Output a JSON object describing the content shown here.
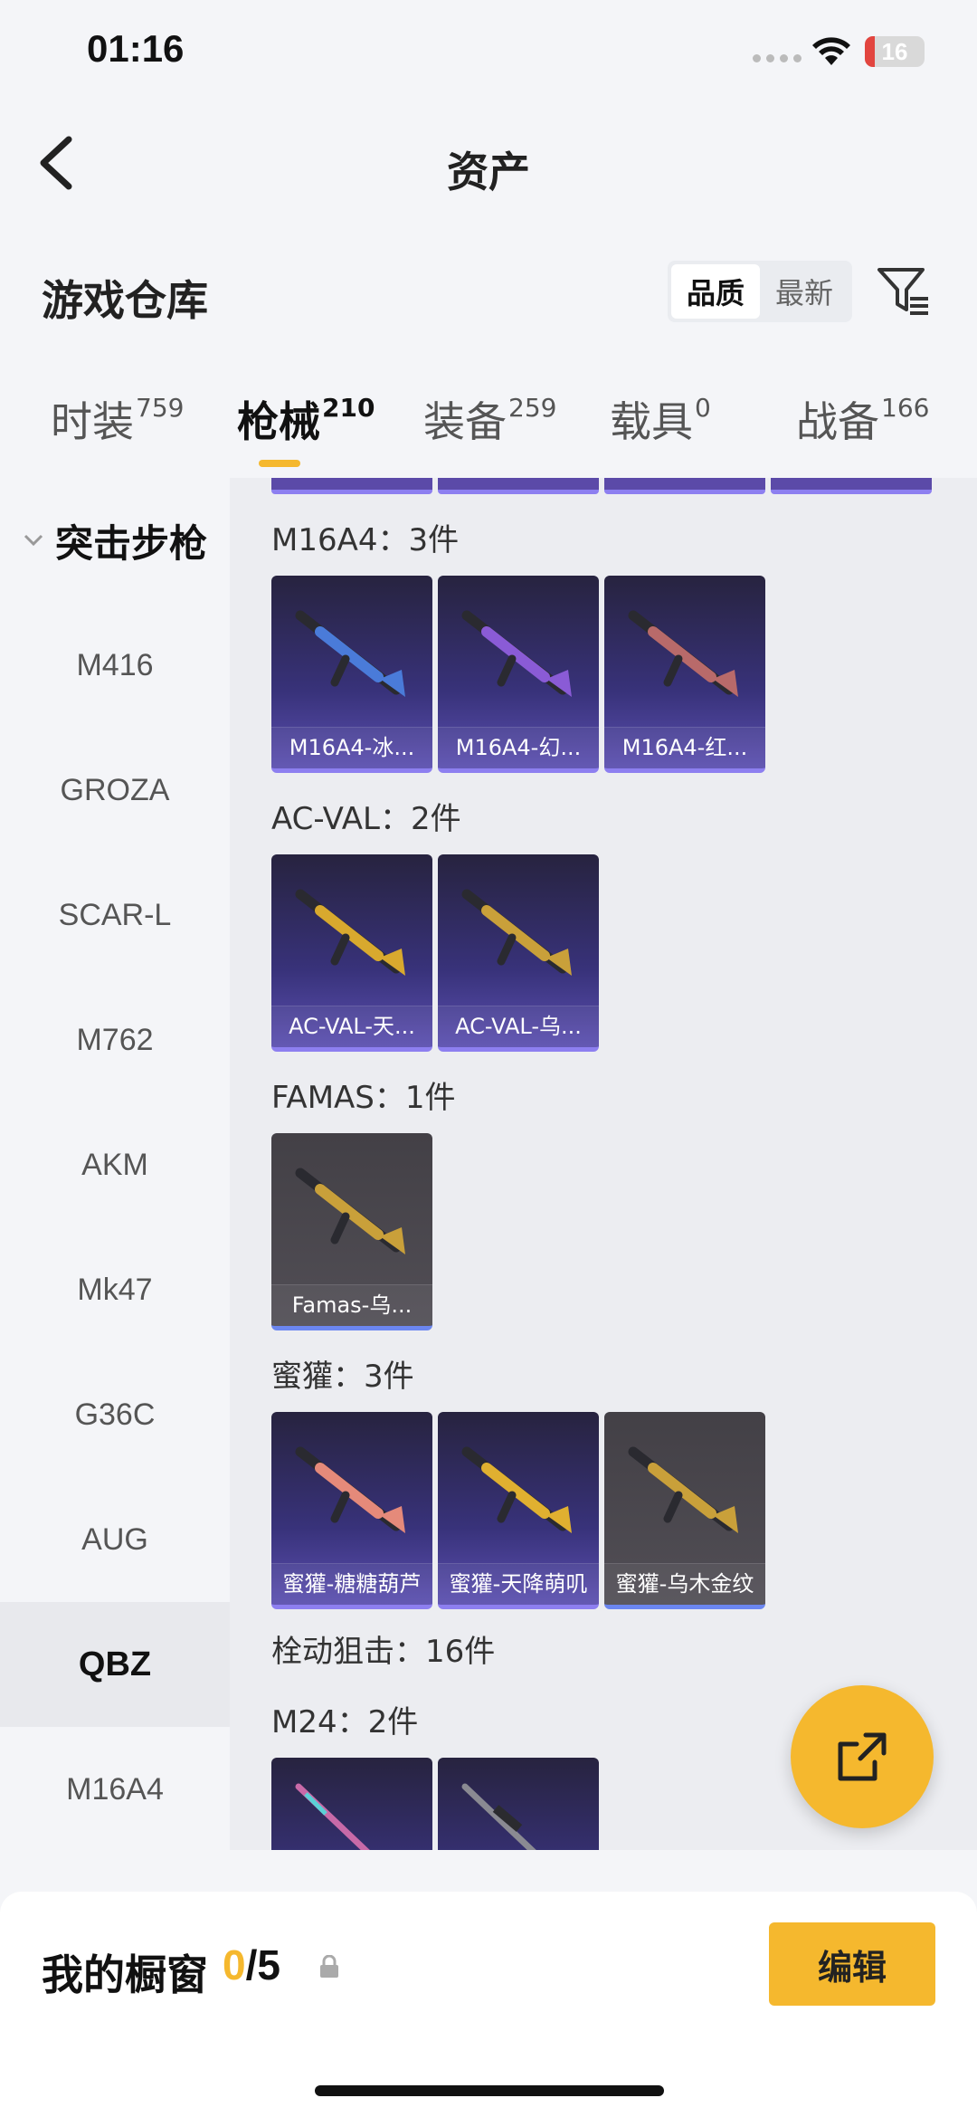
{
  "status_bar": {
    "time": "01:16",
    "battery": "16",
    "battery_level": 0.16
  },
  "nav": {
    "title": "资产"
  },
  "warehouse": {
    "title": "游戏仓库",
    "sort_options": [
      "品质",
      "最新"
    ],
    "active_sort": "品质"
  },
  "tabs": [
    {
      "label": "时装",
      "count": "759"
    },
    {
      "label": "枪械",
      "count": "210"
    },
    {
      "label": "装备",
      "count": "259"
    },
    {
      "label": "载具",
      "count": "0"
    },
    {
      "label": "战备",
      "count": "166"
    }
  ],
  "active_tab": "枪械",
  "sidebar": {
    "group": "突击步枪",
    "items": [
      "M416",
      "GROZA",
      "SCAR-L",
      "M762",
      "AKM",
      "Mk47",
      "G36C",
      "AUG",
      "QBZ",
      "M16A4"
    ],
    "active": "QBZ"
  },
  "groups": [
    {
      "label": "M16A4：3件",
      "items": [
        {
          "name": "M16A4-冰...",
          "rarity": "epic",
          "tint": "#4a7bd9"
        },
        {
          "name": "M16A4-幻...",
          "rarity": "epic",
          "tint": "#8a5bd6"
        },
        {
          "name": "M16A4-红...",
          "rarity": "epic",
          "tint": "#b86a6a"
        }
      ]
    },
    {
      "label": "AC-VAL：2件",
      "items": [
        {
          "name": "AC-VAL-天...",
          "rarity": "epic",
          "tint": "#d8a92e"
        },
        {
          "name": "AC-VAL-乌...",
          "rarity": "epic",
          "tint": "#c9a03a"
        }
      ]
    },
    {
      "label": "FAMAS：1件",
      "items": [
        {
          "name": "Famas-乌...",
          "rarity": "rare",
          "tint": "#c9a03a"
        }
      ]
    },
    {
      "label": "蜜獾：3件",
      "items": [
        {
          "name": "蜜獾-糖糖葫芦",
          "rarity": "epic",
          "tint": "#e58a7a"
        },
        {
          "name": "蜜獾-天降萌叽",
          "rarity": "epic",
          "tint": "#e0b030"
        },
        {
          "name": "蜜獾-乌木金纹",
          "rarity": "rare",
          "tint": "#c9a03a"
        }
      ]
    }
  ],
  "section_label": "栓动狙击：16件",
  "sub_group": {
    "label": "M24：2件"
  },
  "bottom": {
    "title": "我的橱窗",
    "current": "0",
    "total": "/5",
    "edit_label": "编辑"
  },
  "colors": {
    "accent": "#f5b82e",
    "epic_border": "#8d7ff0",
    "rare_border": "#6b86f0"
  }
}
